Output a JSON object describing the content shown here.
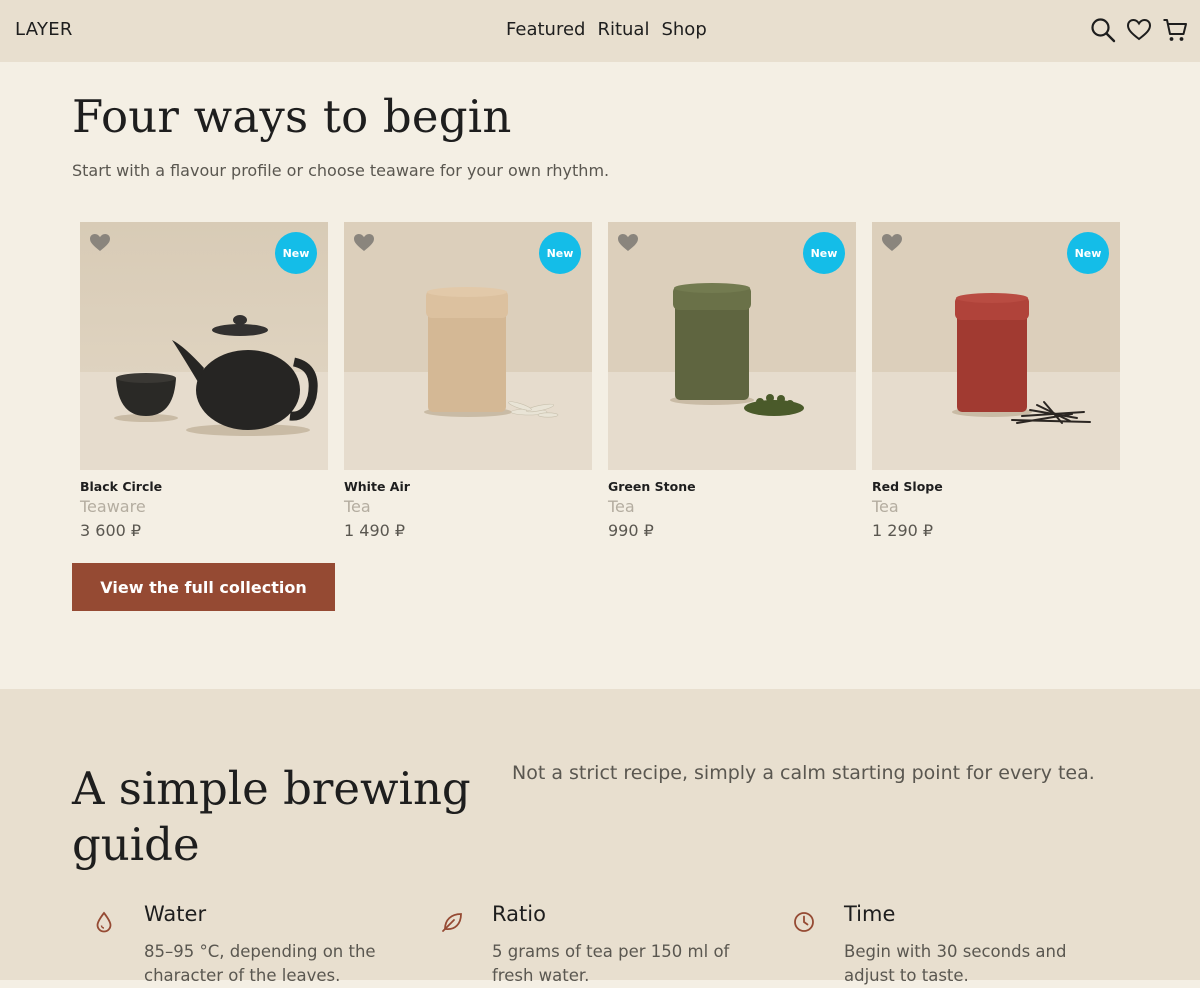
{
  "header": {
    "brand": "LAYER",
    "nav": [
      "Featured",
      "Ritual",
      "Shop"
    ],
    "icons": [
      "search-icon",
      "heart-icon",
      "cart-icon"
    ]
  },
  "collection": {
    "title": "Four ways to begin",
    "subtitle": "Start with a flavour profile or choose teaware for your own rhythm.",
    "badge_color": "#14bde8",
    "products": [
      {
        "name": "Black Circle",
        "category": "Teaware",
        "price": "3 600 ₽",
        "badge": "New"
      },
      {
        "name": "White Air",
        "category": "Tea",
        "price": "1 490 ₽",
        "badge": "New"
      },
      {
        "name": "Green Stone",
        "category": "Tea",
        "price": "990 ₽",
        "badge": "New"
      },
      {
        "name": "Red Slope",
        "category": "Tea",
        "price": "1 290 ₽",
        "badge": "New"
      }
    ],
    "cta_label": "View the full collection",
    "cta_color": "#954a33"
  },
  "guide": {
    "title": "A simple brewing guide",
    "subtitle": "Not a strict recipe, simply a calm starting point for every tea.",
    "steps": [
      {
        "title": "Water",
        "text": "85–95 °C, depending on the character of the leaves.",
        "icon": "water-drop-icon"
      },
      {
        "title": "Ratio",
        "text": "5 grams of tea per 150 ml of fresh water.",
        "icon": "leaf-icon"
      },
      {
        "title": "Time",
        "text": "Begin with 30 seconds and adjust to taste.",
        "icon": "clock-icon"
      }
    ]
  }
}
